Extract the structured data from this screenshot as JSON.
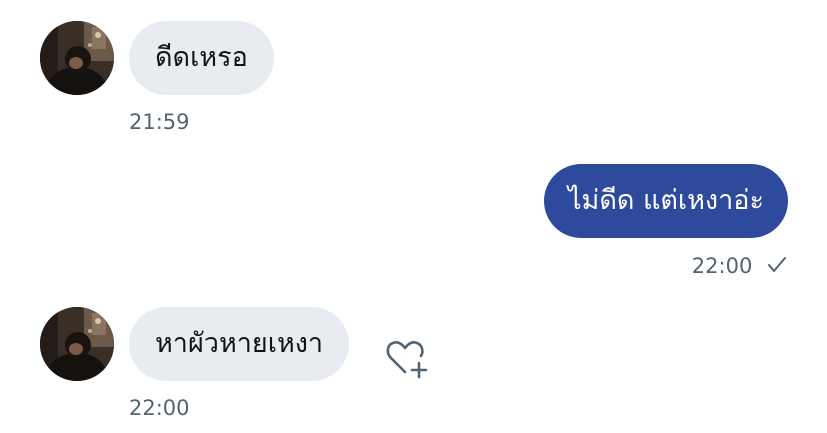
{
  "messages": [
    {
      "direction": "incoming",
      "text": "ดีดเหรอ",
      "time": "21:59"
    },
    {
      "direction": "outgoing",
      "text": "ไม่ดีด แต่เหงาอ่ะ",
      "time": "22:00",
      "status_icon": "check-icon"
    },
    {
      "direction": "incoming",
      "text": "หาผัวหายเหงา",
      "time": "22:00",
      "reaction_icon": "heart-add-icon"
    }
  ],
  "colors": {
    "incoming_bubble": "#e8ebf0",
    "outgoing_bubble": "#2e4a9c",
    "timestamp": "#536471",
    "text": "#0f1419"
  }
}
